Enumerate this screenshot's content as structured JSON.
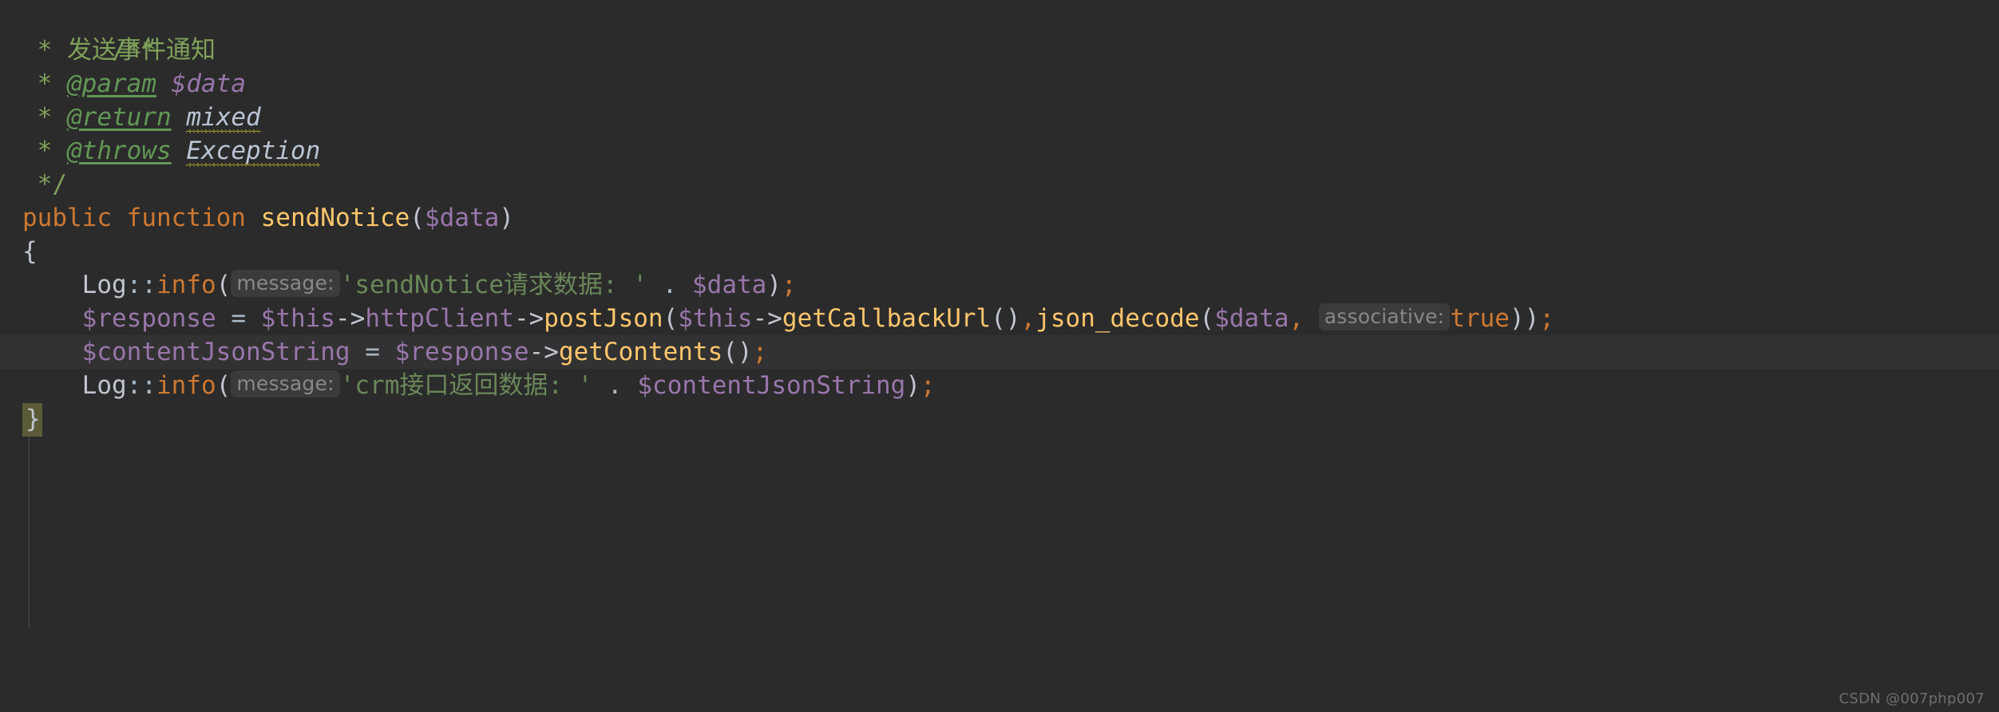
{
  "editor": {
    "language": "php",
    "theme": "darcula",
    "background_color": "#2b2b2b",
    "current_line_background": "#323232",
    "colors": {
      "comment": "#7fa05a",
      "comment_tag": "#629755",
      "comment_variable": "#9876aa",
      "comment_type": "#b9c4d4",
      "keyword": "#cc7832",
      "function_name": "#ffc66d",
      "variable": "#9876aa",
      "string": "#6a8759",
      "plain_text": "#c0c5ce",
      "inlay_hint_background": "#3b3b3b",
      "inlay_hint_text": "#888888",
      "squiggle_warning": "#bbb529",
      "brace_match_background": "#5b5b38",
      "indent_guide": "#4b4b4b",
      "watermark": "#6e6e6e"
    }
  },
  "code": {
    "doc_open": "/**",
    "doc_star": "*",
    "doc_summary": "发送事件通知",
    "tag_param": "@param",
    "tag_param_value": "$data",
    "tag_return": "@return",
    "tag_return_type": "mixed",
    "tag_throws": "@throws",
    "tag_throws_type": "Exception",
    "doc_close": "*/",
    "modifier": "public",
    "keyword_function": "function",
    "method_name": "sendNotice",
    "paren_open": "(",
    "param_data": "$data",
    "paren_close": ")",
    "brace_open": "{",
    "brace_close": "}",
    "log_class": "Log",
    "scope_resolution": "::",
    "log_method": "info",
    "hint_message": "message:",
    "hint_associative": "associative:",
    "string_request": "'sendNotice请求数据: '",
    "concat": ".",
    "var_data": "$data",
    "close_semi": ");",
    "var_response": "$response",
    "assign": "=",
    "var_this": "$this",
    "arrow": "->",
    "prop_http_client": "httpClient",
    "method_post_json": "postJson",
    "method_get_callback_url": "getCallbackUrl",
    "empty_parens": "()",
    "comma": ",",
    "fn_json_decode": "json_decode",
    "literal_true": "true",
    "tail_double_close": "));",
    "var_content_json_string": "$contentJsonString",
    "method_get_contents": "getContents",
    "string_response": "'crm接口返回数据: '",
    "var_content_json_string_arg": "$contentJsonString"
  },
  "watermark": {
    "text": "CSDN @007php007"
  }
}
